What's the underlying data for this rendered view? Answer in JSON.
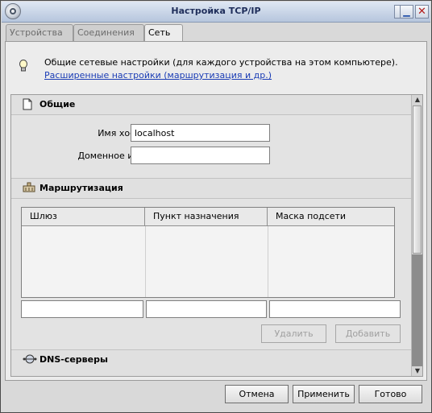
{
  "window": {
    "title": "Настройка TCP/IP"
  },
  "tabs": [
    {
      "label": "Устройства",
      "active": false
    },
    {
      "label": "Соединения",
      "active": false
    },
    {
      "label": "Сеть",
      "active": true
    }
  ],
  "info": {
    "text": "Общие сетевые настройки (для каждого устройства на этом компьютере).",
    "link": "Расширенные настройки (маршрутизация и др.)"
  },
  "general": {
    "title": "Общие",
    "hostname_label": "Имя хоста:",
    "hostname_value": "localhost",
    "domain_label": "Доменное имя:",
    "domain_value": ""
  },
  "routing": {
    "title": "Маршрутизация",
    "columns": [
      "Шлюз",
      "Пункт назначения",
      "Маска подсети"
    ],
    "rows": [],
    "inputs": [
      "",
      "",
      ""
    ],
    "delete_label": "Удалить",
    "add_label": "Добавить"
  },
  "dns": {
    "title": "DNS-серверы"
  },
  "footer": {
    "cancel": "Отмена",
    "apply": "Применить",
    "done": "Готово"
  },
  "icons": {
    "app": "network-settings-icon",
    "info": "lightbulb-icon",
    "general": "document-icon",
    "routing": "router-icon",
    "dns": "dns-icon"
  }
}
